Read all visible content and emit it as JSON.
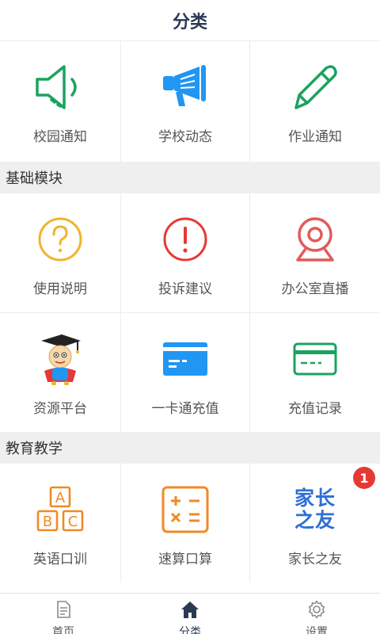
{
  "header": {
    "title": "分类"
  },
  "top_items": [
    {
      "label": "校园通知",
      "icon": "speaker-icon"
    },
    {
      "label": "学校动态",
      "icon": "megaphone-icon"
    },
    {
      "label": "作业通知",
      "icon": "pencil-icon"
    }
  ],
  "sections": [
    {
      "title": "基础模块",
      "items": [
        {
          "label": "使用说明",
          "icon": "question-icon"
        },
        {
          "label": "投诉建议",
          "icon": "exclamation-icon"
        },
        {
          "label": "办公室直播",
          "icon": "webcam-icon"
        },
        {
          "label": "资源平台",
          "icon": "scholar-mascot-icon"
        },
        {
          "label": "一卡通充值",
          "icon": "card-icon"
        },
        {
          "label": "充值记录",
          "icon": "card-outline-icon"
        }
      ]
    },
    {
      "title": "教育教学",
      "items": [
        {
          "label": "英语口训",
          "icon": "abc-blocks-icon"
        },
        {
          "label": "速算口算",
          "icon": "calculator-icon"
        },
        {
          "label": "家长之友",
          "icon": "parents-friend-logo",
          "badge": "1",
          "logo_text": "家长之友"
        }
      ]
    }
  ],
  "tabbar": [
    {
      "label": "首页",
      "icon": "document-icon"
    },
    {
      "label": "分类",
      "icon": "home-icon",
      "active": true
    },
    {
      "label": "设置",
      "icon": "gear-icon"
    }
  ],
  "colors": {
    "green": "#1aa35f",
    "blue": "#2196f3",
    "yellow": "#f0b429",
    "red": "#e53935",
    "orange": "#f08a24",
    "navy": "#2a3a55"
  }
}
